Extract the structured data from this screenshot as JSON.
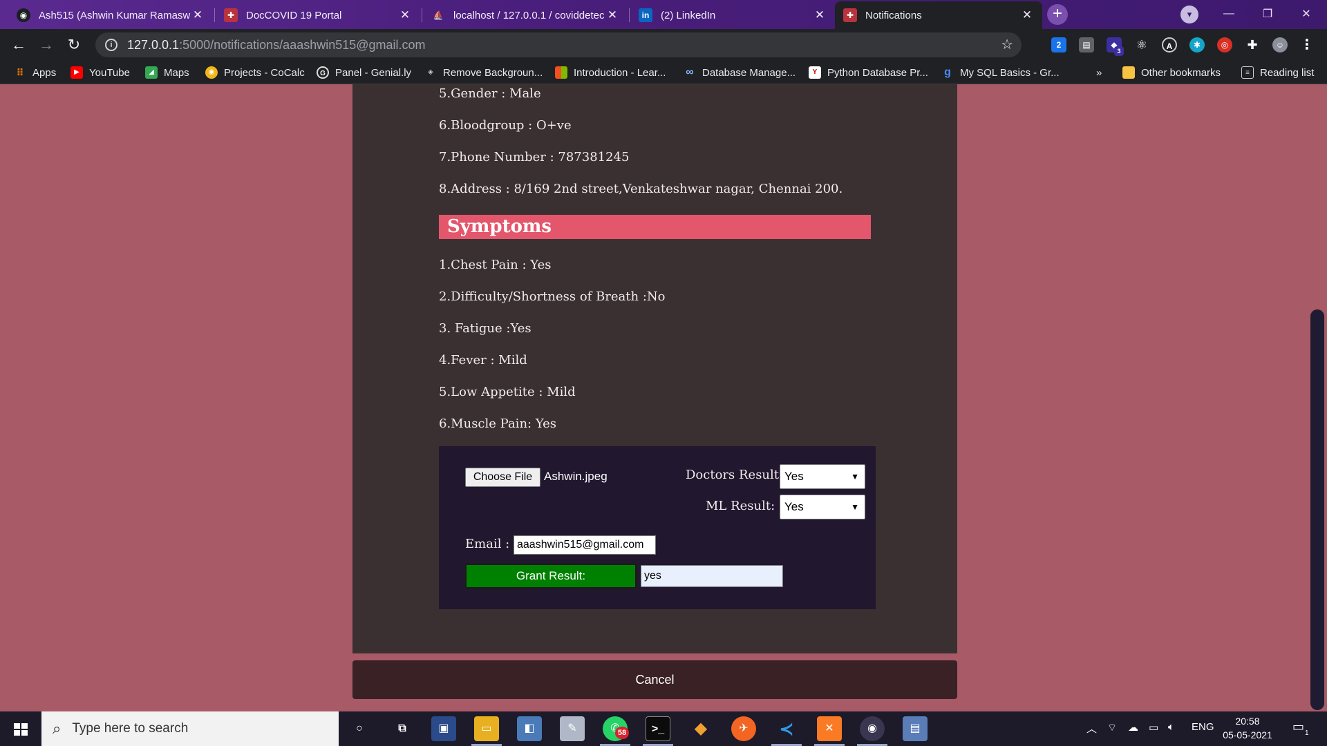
{
  "tabs": [
    {
      "title": "Ash515 (Ashwin Kumar Ramaswa",
      "icon": "github-icon"
    },
    {
      "title": "DocCOVID 19 Portal",
      "icon": "site-icon"
    },
    {
      "title": "localhost / 127.0.0.1 / coviddetec",
      "icon": "phpmyadmin-icon"
    },
    {
      "title": "(2) LinkedIn",
      "icon": "linkedin-icon"
    },
    {
      "title": "Notifications",
      "icon": "site-icon"
    }
  ],
  "address_bar": {
    "host": "127.0.0.1",
    "path": ":5000/notifications/aaashwin515@gmail.com"
  },
  "bookmarks": [
    {
      "label": "Apps"
    },
    {
      "label": "YouTube"
    },
    {
      "label": "Maps"
    },
    {
      "label": "Projects - CoCalc"
    },
    {
      "label": "Panel - Genial.ly"
    },
    {
      "label": "Remove Backgroun..."
    },
    {
      "label": "Introduction - Lear..."
    },
    {
      "label": "Database Manage..."
    },
    {
      "label": "Python Database Pr..."
    },
    {
      "label": "My SQL Basics - Gr..."
    }
  ],
  "bookmarks_overflow": "»",
  "other_bookmarks": "Other bookmarks",
  "reading_list": "Reading list",
  "extension_badge": "2",
  "extension_badge2": "3",
  "patient": {
    "gender": "5.Gender : Male",
    "bloodgroup": "6.Bloodgroup : O+ve",
    "phone": "7.Phone Number : 787381245",
    "address": "8.Address : 8/169 2nd street,Venkateshwar nagar, Chennai 200."
  },
  "symptoms_heading": "Symptoms",
  "symptoms": [
    "1.Chest Pain : Yes",
    "2.Difficulty/Shortness of Breath :No",
    "3. Fatigue :Yes",
    "4.Fever : Mild",
    "5.Low Appetite : Mild",
    "6.Muscle Pain: Yes"
  ],
  "form": {
    "choose_file": "Choose File",
    "file_name": "Ashwin.jpeg",
    "doctors_result_label": "Doctors Result:",
    "doctors_result_value": "Yes",
    "ml_result_label": "ML Result:",
    "ml_result_value": "Yes",
    "email_label": "Email :",
    "email_value": "aaashwin515@gmail.com",
    "grant_label": "Grant Result:",
    "grant_value": "yes"
  },
  "cancel_label": "Cancel",
  "taskbar": {
    "search_placeholder": "Type here to search",
    "whatsapp_badge": "58",
    "language": "ENG",
    "time": "20:58",
    "date": "05-05-2021",
    "notification_count": "1"
  },
  "colors": {
    "accent_heading": "#e4566b",
    "grant_button": "#008000",
    "page_bg": "#a85a66",
    "card_bg": "#3b3031"
  }
}
